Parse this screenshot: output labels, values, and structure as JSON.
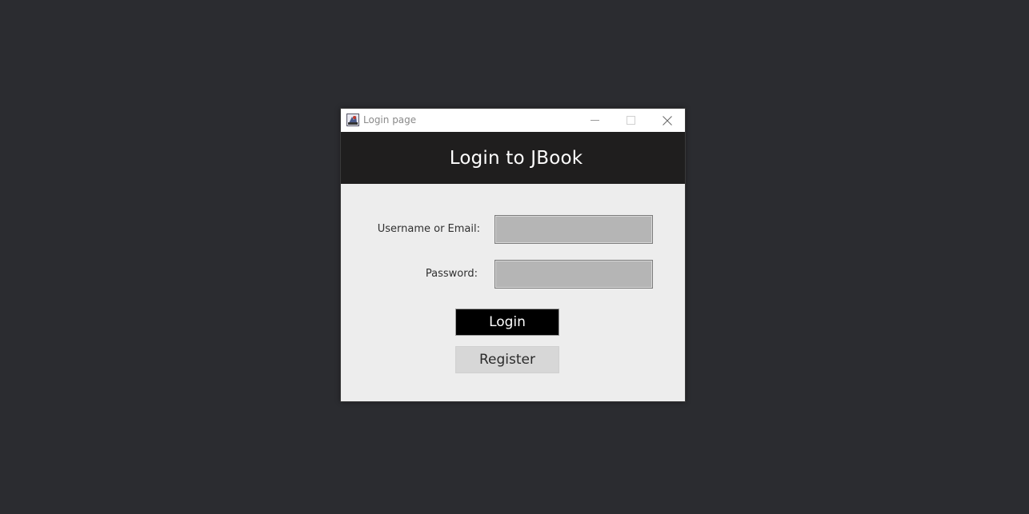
{
  "window": {
    "title": "Login page",
    "app_icon": "java-app-icon",
    "controls": {
      "minimize_icon": "minimize-icon",
      "maximize_icon": "maximize-icon",
      "close_icon": "close-icon"
    }
  },
  "header": {
    "title": "Login to JBook",
    "background": "#1f1e1e"
  },
  "form": {
    "username_label": "Username or Email:",
    "username_value": "",
    "password_label": "Password:",
    "password_value": "",
    "field_color": "#b5b5b5"
  },
  "buttons": {
    "login_label": "Login",
    "register_label": "Register"
  },
  "colors": {
    "desktop": "#2b2c30",
    "window_body": "#ededed",
    "login_button": "#000000",
    "register_button": "#d7d7d7"
  }
}
